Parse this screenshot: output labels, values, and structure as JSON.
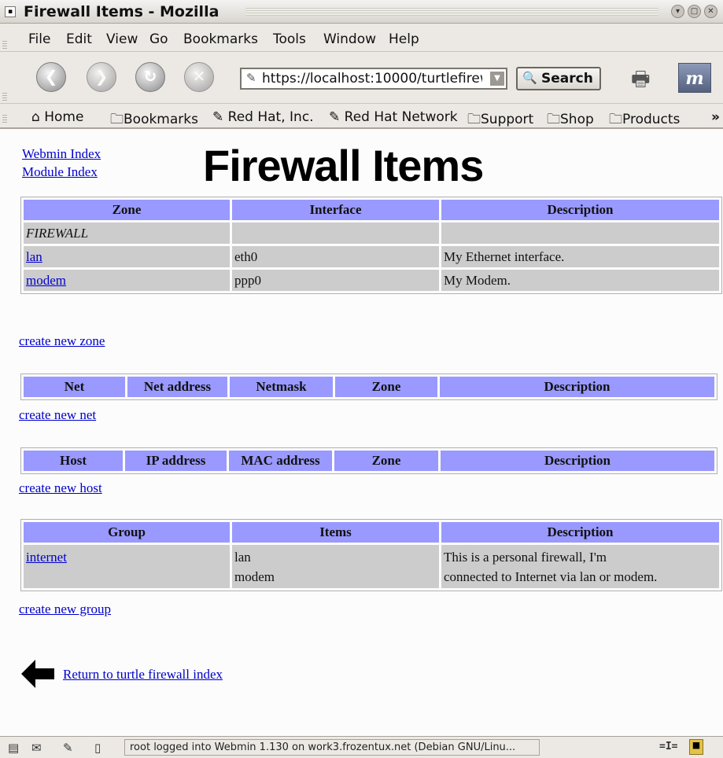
{
  "window": {
    "title": "Firewall Items - Mozilla"
  },
  "menu": [
    "File",
    "Edit",
    "View",
    "Go",
    "Bookmarks",
    "Tools",
    "Window",
    "Help"
  ],
  "navigation": {
    "url": "https://localhost:10000/turtlefirew",
    "search_label": "Search"
  },
  "bookmarks": [
    "Home",
    "Bookmarks",
    "Red Hat, Inc.",
    "Red Hat Network",
    "Support",
    "Shop",
    "Products",
    "»"
  ],
  "page": {
    "links": {
      "webmin_index": "Webmin Index",
      "module_index": "Module Index"
    },
    "title": "Firewall Items",
    "zones": {
      "headers": [
        "Zone",
        "Interface",
        "Description"
      ],
      "rows": [
        [
          "FIREWALL",
          "",
          ""
        ],
        [
          "lan",
          "eth0",
          "My Ethernet interface."
        ],
        [
          "modem",
          "ppp0",
          "My Modem."
        ]
      ],
      "create_link": "create new zone"
    },
    "nets": {
      "headers": [
        "Net",
        "Net address",
        "Netmask",
        "Zone",
        "Description"
      ],
      "create_link": "create new net"
    },
    "hosts": {
      "headers": [
        "Host",
        "IP address",
        "MAC address",
        "Zone",
        "Description"
      ],
      "create_link": "create new host"
    },
    "groups": {
      "headers": [
        "Group",
        "Items",
        "Description"
      ],
      "rows": [
        {
          "group": "internet",
          "items": [
            "lan",
            "modem"
          ],
          "description": [
            "This is a personal firewall, I'm",
            "connected to Internet via lan or modem."
          ]
        }
      ],
      "create_link": "create new group"
    },
    "return_link": "Return to turtle firewall index"
  },
  "status": {
    "text": "root logged into Webmin 1.130 on work3.frozentux.net (Debian GNU/Linu..."
  },
  "colors": {
    "header_bg": "#9999ff",
    "cell_bg": "#cccccc",
    "link": "#0000cc"
  }
}
